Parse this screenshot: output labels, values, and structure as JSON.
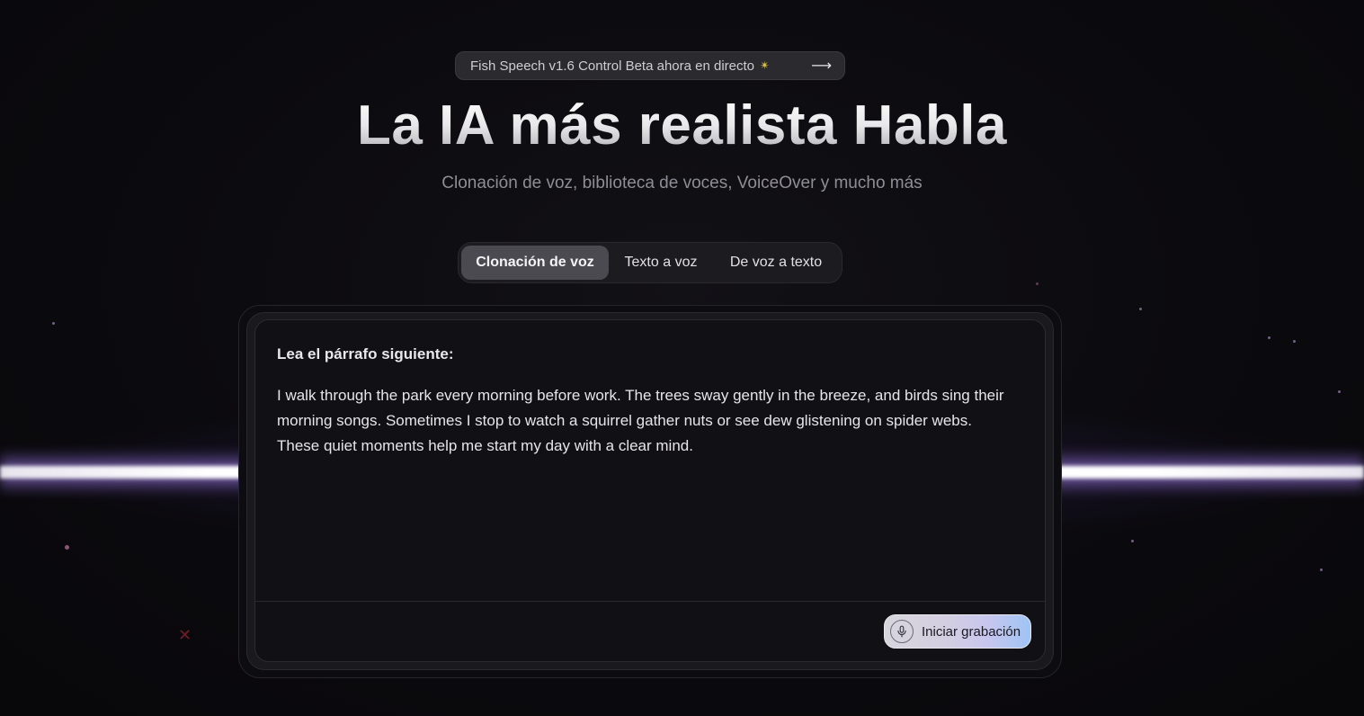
{
  "announcement": {
    "text": "Fish Speech v1.6 Control Beta ahora en directo",
    "sparkle_icon": "sparkle-icon",
    "arrow_icon": "arrow-right-icon"
  },
  "hero": {
    "title": "La IA más realista Habla",
    "subtitle": "Clonación de voz, biblioteca de voces, VoiceOver y mucho más"
  },
  "tabs": [
    {
      "label": "Clonación de voz",
      "active": true
    },
    {
      "label": "Texto a voz",
      "active": false
    },
    {
      "label": "De voz a texto",
      "active": false
    }
  ],
  "card": {
    "prompt_label": "Lea el párrafo siguiente:",
    "paragraph": "I walk through the park every morning before work. The trees sway gently in the breeze, and birds sing their morning songs. Sometimes I stop to watch a squirrel gather nuts or see dew glistening on spider webs. These quiet moments help me start my day with a clear mind.",
    "record_button": {
      "label": "Iniciar grabación",
      "icon": "microphone-icon"
    }
  },
  "colors": {
    "background": "#0a090c",
    "beam_glow": "#b48cff",
    "active_tab": "#4b4a50"
  }
}
